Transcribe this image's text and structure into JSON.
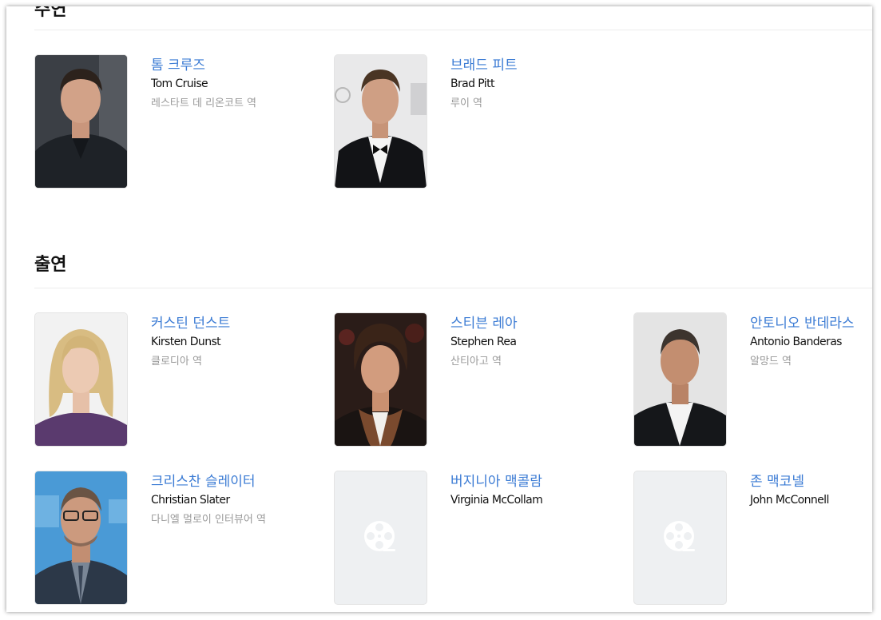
{
  "sections": {
    "lead": {
      "heading": "주연",
      "people": [
        {
          "name_ko": "톰 크루즈",
          "name_en": "Tom Cruise",
          "role": "레스타트 데 리온코트 역",
          "photo": "tom-cruise-photo"
        },
        {
          "name_ko": "브래드 피트",
          "name_en": "Brad Pitt",
          "role": "루이 역",
          "photo": "brad-pitt-photo"
        }
      ]
    },
    "cast": {
      "heading": "출연",
      "people": [
        {
          "name_ko": "커스틴 던스트",
          "name_en": "Kirsten Dunst",
          "role": "클로디아 역",
          "photo": "kirsten-dunst-photo"
        },
        {
          "name_ko": "스티븐 레아",
          "name_en": "Stephen Rea",
          "role": "산티아고 역",
          "photo": "stephen-rea-photo"
        },
        {
          "name_ko": "안토니오 반데라스",
          "name_en": "Antonio Banderas",
          "role": "알망드 역",
          "photo": "antonio-banderas-photo"
        },
        {
          "name_ko": "크리스찬 슬레이터",
          "name_en": "Christian Slater",
          "role": "다니엘 멀로이 인터뷰어 역",
          "photo": "christian-slater-photo"
        },
        {
          "name_ko": "버지니아 맥콜람",
          "name_en": "Virginia McCollam",
          "role": "",
          "photo": "film-reel-placeholder-icon"
        },
        {
          "name_ko": "존 맥코넬",
          "name_en": "John McConnell",
          "role": "",
          "photo": "film-reel-placeholder-icon"
        }
      ]
    }
  },
  "colors": {
    "name_link": "#3b7bd4",
    "role_text": "#999999",
    "placeholder_bg": "#eef0f2"
  }
}
